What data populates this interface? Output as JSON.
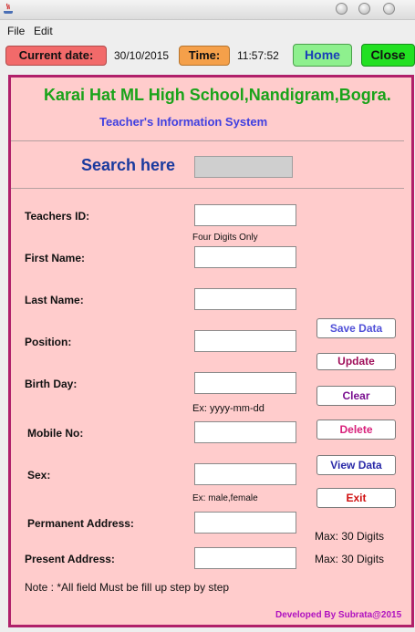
{
  "menu": {
    "file": "File",
    "edit": "Edit"
  },
  "topbar": {
    "date_label": "Current date:",
    "date_value": "30/10/2015",
    "time_label": "Time:",
    "time_value": "11:57:52",
    "home": "Home",
    "close": "Close"
  },
  "header": {
    "school": "Karai Hat ML High School,Nandigram,Bogra.",
    "subtitle": "Teacher's Information System"
  },
  "search": {
    "label": "Search here",
    "value": ""
  },
  "form": {
    "teachers_id": "Teachers ID:",
    "id_hint": "Four Digits Only",
    "first_name": "First Name:",
    "last_name": "Last Name:",
    "position": "Position:",
    "birth_day": "Birth Day:",
    "birth_hint": "Ex: yyyy-mm-dd",
    "mobile": "Mobile No:",
    "sex": "Sex:",
    "sex_hint": "Ex: male,female",
    "permanent_address": "Permanent Address:",
    "permanent_hint": "Max: 30 Digits",
    "present_address": "Present Address:",
    "present_hint": "Max: 30 Digits"
  },
  "actions": {
    "save": "Save Data",
    "update": "Update",
    "clear": "Clear",
    "delete": "Delete",
    "view": "View Data",
    "exit": "Exit"
  },
  "action_colors": {
    "save": "#5050d8",
    "update": "#a0105a",
    "clear": "#7a1090",
    "delete": "#d8207a",
    "view": "#2a2aa8",
    "exit": "#d01010"
  },
  "footer": {
    "note": "Note : *All field Must be fill up step by step",
    "developer": "Developed By Subrata@2015"
  }
}
